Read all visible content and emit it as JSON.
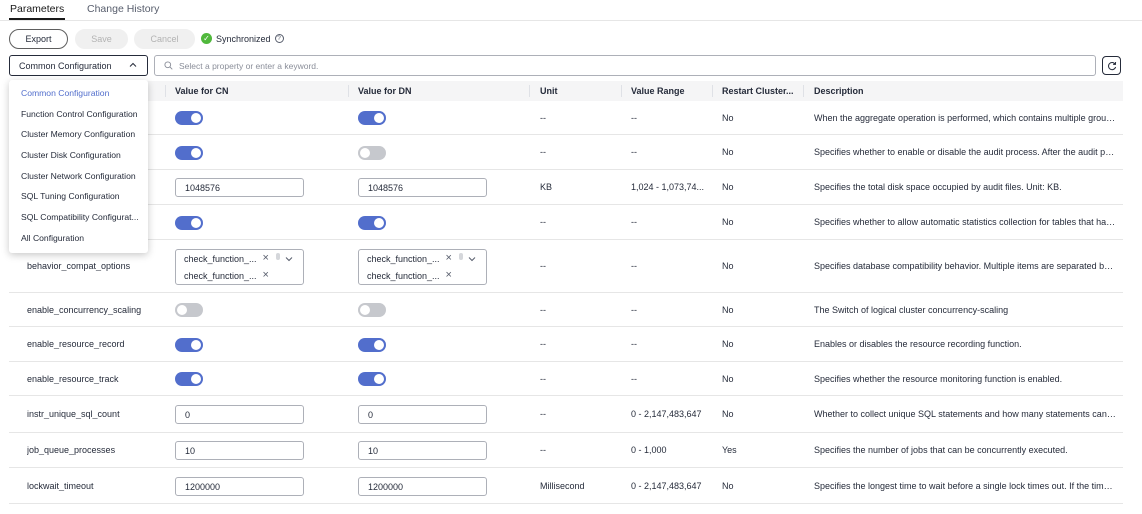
{
  "tabs": [
    {
      "label": "Parameters",
      "active": true
    },
    {
      "label": "Change History",
      "active": false
    }
  ],
  "toolbar": {
    "export_label": "Export",
    "save_label": "Save",
    "cancel_label": "Cancel",
    "status_label": "Synchronized",
    "status_icon": "check-circle-icon",
    "help_icon": "question-icon"
  },
  "filter": {
    "selected": "Common Configuration",
    "search_placeholder": "Select a property or enter a keyword.",
    "options": [
      "Common Configuration",
      "Function Control Configuration",
      "Cluster Memory Configuration",
      "Cluster Disk Configuration",
      "Cluster Network Configuration",
      "SQL Tuning Configuration",
      "SQL Compatibility Configurat...",
      "All Configuration"
    ]
  },
  "table": {
    "headers": [
      "Value for CN",
      "Value for DN",
      "Unit",
      "Value Range",
      "Restart Cluster...",
      "Description"
    ],
    "rows": [
      {
        "name": "",
        "cn": {
          "type": "toggle",
          "on": true
        },
        "dn": {
          "type": "toggle",
          "on": true
        },
        "unit": "--",
        "range": "--",
        "restart": "No",
        "desc": "When the aggregate operation is performed, which contains multiple group by ..."
      },
      {
        "name": "",
        "cn": {
          "type": "toggle",
          "on": true
        },
        "dn": {
          "type": "toggle",
          "on": false
        },
        "unit": "--",
        "range": "--",
        "restart": "No",
        "desc": "Specifies whether to enable or disable the audit process. After the audit proces..."
      },
      {
        "name": "",
        "cn": {
          "type": "input",
          "value": "1048576"
        },
        "dn": {
          "type": "input",
          "value": "1048576"
        },
        "unit": "KB",
        "range": "1,024 - 1,073,74...",
        "restart": "No",
        "desc": "Specifies the total disk space occupied by audit files. Unit: KB."
      },
      {
        "name": "",
        "cn": {
          "type": "toggle",
          "on": true
        },
        "dn": {
          "type": "toggle",
          "on": true
        },
        "unit": "--",
        "range": "--",
        "restart": "No",
        "desc": "Specifies whether to allow automatic statistics collection for tables that have st..."
      },
      {
        "name": "behavior_compat_options",
        "cn": {
          "type": "multi",
          "tags": [
            "check_function_...",
            "check_function_..."
          ]
        },
        "dn": {
          "type": "multi",
          "tags": [
            "check_function_...",
            "check_function_..."
          ]
        },
        "unit": "--",
        "range": "--",
        "restart": "No",
        "desc": "Specifies database compatibility behavior. Multiple items are separated by com..."
      },
      {
        "name": "enable_concurrency_scaling",
        "cn": {
          "type": "toggle",
          "on": false
        },
        "dn": {
          "type": "toggle",
          "on": false
        },
        "unit": "--",
        "range": "--",
        "restart": "No",
        "desc": "The Switch of logical cluster concurrency-scaling"
      },
      {
        "name": "enable_resource_record",
        "cn": {
          "type": "toggle",
          "on": true
        },
        "dn": {
          "type": "toggle",
          "on": true
        },
        "unit": "--",
        "range": "--",
        "restart": "No",
        "desc": "Enables or disables the resource recording function."
      },
      {
        "name": "enable_resource_track",
        "cn": {
          "type": "toggle",
          "on": true
        },
        "dn": {
          "type": "toggle",
          "on": true
        },
        "unit": "--",
        "range": "--",
        "restart": "No",
        "desc": "Specifies whether the resource monitoring function is enabled."
      },
      {
        "name": "instr_unique_sql_count",
        "cn": {
          "type": "input",
          "value": "0"
        },
        "dn": {
          "type": "input",
          "value": "0"
        },
        "unit": "--",
        "range": "0 - 2,147,483,647",
        "restart": "No",
        "desc": "Whether to collect unique SQL statements and how many statements can be c..."
      },
      {
        "name": "job_queue_processes",
        "cn": {
          "type": "input",
          "value": "10"
        },
        "dn": {
          "type": "input",
          "value": "10"
        },
        "unit": "--",
        "range": "0 - 1,000",
        "restart": "Yes",
        "desc": "Specifies the number of jobs that can be concurrently executed."
      },
      {
        "name": "lockwait_timeout",
        "cn": {
          "type": "input",
          "value": "1200000"
        },
        "dn": {
          "type": "input",
          "value": "1200000"
        },
        "unit": "Millisecond",
        "range": "0 - 2,147,483,647",
        "restart": "No",
        "desc": "Specifies the longest time to wait before a single lock times out. If the time you ..."
      }
    ]
  }
}
